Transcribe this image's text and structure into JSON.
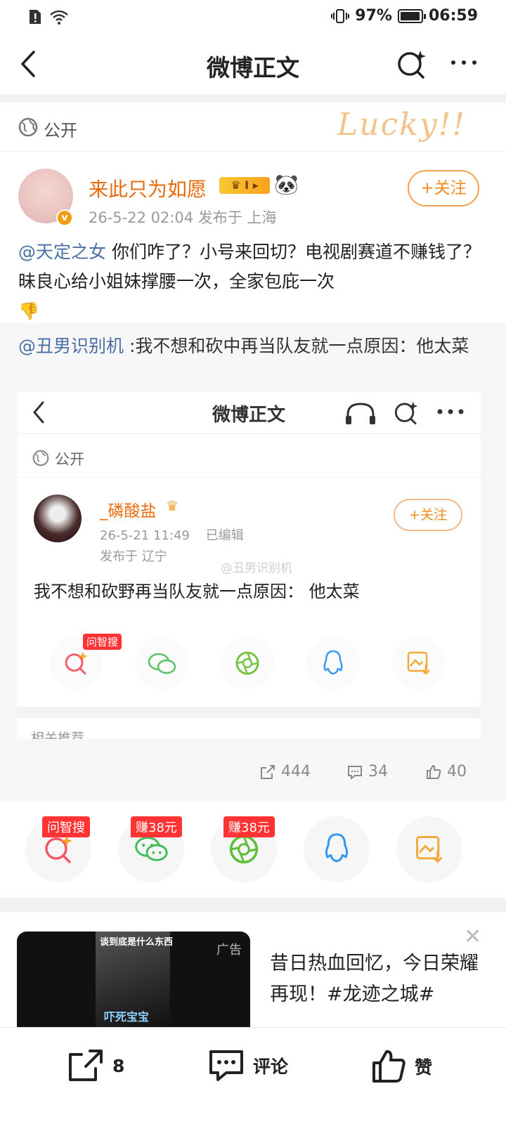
{
  "status_bar": {
    "battery": "97%",
    "time": "06:59"
  },
  "header": {
    "title": "微博正文"
  },
  "visibility": {
    "label": "公开",
    "decoration_text": "Lucky!!"
  },
  "post": {
    "author": "来此只为如愿",
    "level_badge": "I",
    "meta": "26-5-22 02:04  发布于 上海",
    "follow_label": "+关注",
    "mention": "@天定之女",
    "text": " 你们咋了？小号来回切？电视剧赛道不赚钱了？昧良心给小姐妹撑腰一次，全家包庇一次"
  },
  "repost": {
    "mention": "@丑男识别机",
    "text": " :我不想和砍中再当队友就一点原因：他太菜",
    "screenshot": {
      "title": "微博正文",
      "public_label": "公开",
      "author": "_磷酸盐",
      "time": "26-5-21 11:49",
      "edited": "已编辑",
      "location": "发布于 辽宁",
      "follow_label": "+关注",
      "watermark": "@丑男识别机",
      "text": "我不想和砍野再当队友就一点原因： 他太菜",
      "share_tag": "问智搜",
      "related": "相关推荐"
    },
    "stats": {
      "reposts": "444",
      "comments": "34",
      "likes": "40"
    }
  },
  "share_row": {
    "tags": [
      "问智搜",
      "赚38元",
      "赚38元"
    ]
  },
  "ad": {
    "label": "广告",
    "caption_top": "谈到底是什么东西",
    "caption_bottom": "吓死宝宝",
    "title": "昔日热血回忆，今日荣耀再现！#龙迹之城#"
  },
  "bottom_bar": {
    "repost_count": "8",
    "comment_label": "评论",
    "like_label": "赞"
  },
  "colors": {
    "accent": "#ef8c1c",
    "link": "#4a6fa5",
    "tag_red": "#ff3333"
  }
}
